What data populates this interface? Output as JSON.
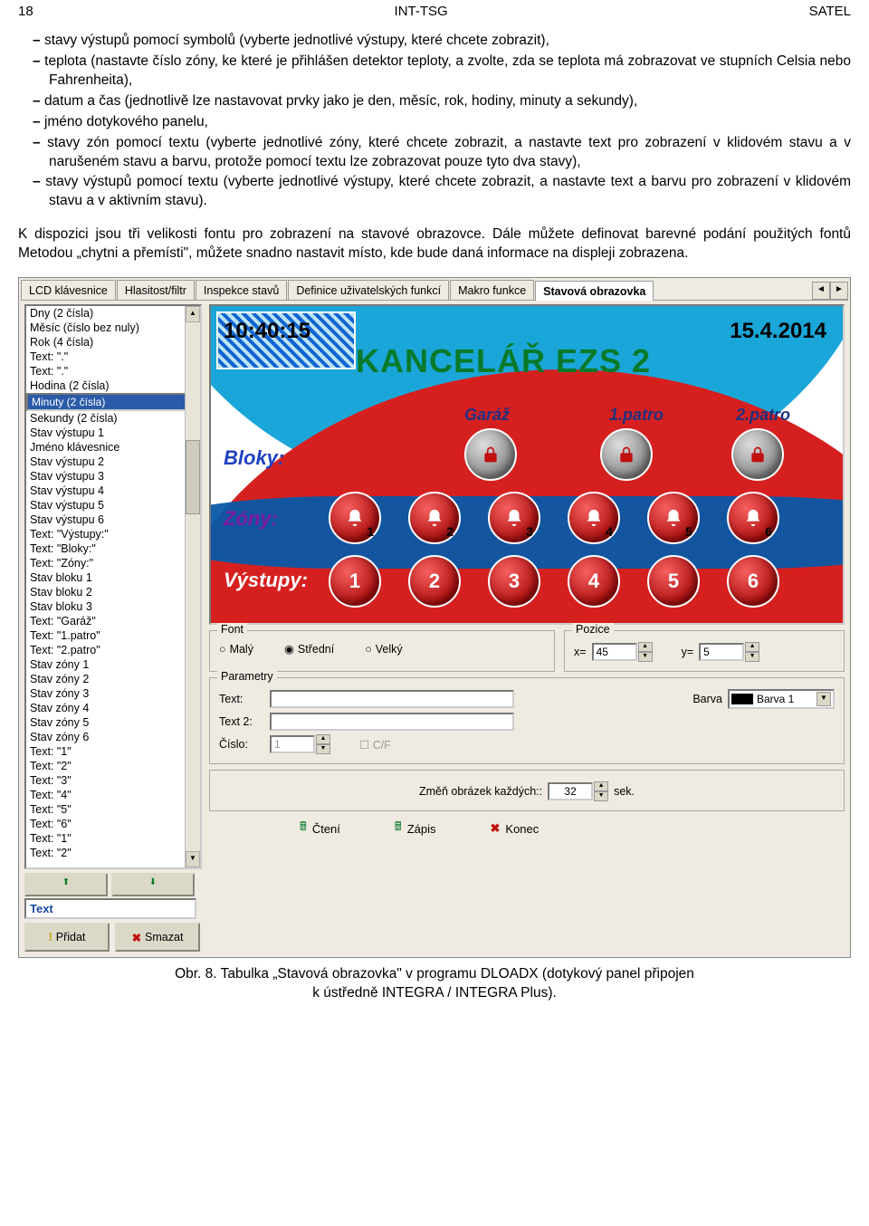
{
  "header": {
    "page": "18",
    "center": "INT-TSG",
    "right": "SATEL"
  },
  "text": {
    "li1": "stavy výstupů pomocí symbolů (vyberte jednotlivé výstupy, které chcete zobrazit),",
    "li2": "teplota (nastavte číslo zóny, ke které je přihlášen detektor teploty, a zvolte, zda se teplota má zobrazovat ve stupních Celsia nebo Fahrenheita),",
    "li3": "datum a čas (jednotlivě lze nastavovat prvky jako je den, měsíc, rok, hodiny, minuty a sekundy),",
    "li4": "jméno dotykového panelu,",
    "li5": "stavy zón pomocí textu (vyberte jednotlivé zóny, které chcete zobrazit, a nastavte text pro zobrazení v klidovém stavu a v narušeném stavu a barvu, protože pomocí textu lze zobrazovat pouze tyto dva stavy),",
    "li6": "stavy výstupů pomocí textu (vyberte jednotlivé výstupy, které chcete zobrazit, a nastavte text a barvu pro zobrazení v klidovém stavu a v aktivním stavu).",
    "para": "K dispozici jsou tři velikosti fontu pro zobrazení na stavové obrazovce. Dále můžete definovat barevné podání použitých fontů Metodou „chytni a přemísti\", můžete snadno nastavit místo, kde bude daná informace na displeji zobrazena."
  },
  "tabs": {
    "t1": "LCD klávesnice",
    "t2": "Hlasitost/filtr",
    "t3": "Inspekce stavů",
    "t4": "Definice uživatelských funkcí",
    "t5": "Makro funkce",
    "t6": "Stavová obrazovka"
  },
  "list": [
    "Dny (2 čísla)",
    "Měsíc (číslo bez nuly)",
    "Rok (4 čísla)",
    "Text: \".\"",
    "Text: \".\"",
    "Hodina (2 čísla)",
    "Minuty (2 čísla)",
    "Sekundy (2 čísla)",
    "Stav výstupu 1",
    "Jméno klávesnice",
    "Stav výstupu 2",
    "Stav výstupu 3",
    "Stav výstupu 4",
    "Stav výstupu 5",
    "Stav výstupu 6",
    "Text: \"Výstupy:\"",
    "Text: \"Bloky:\"",
    "Text: \"Zóny:\"",
    "Stav bloku 1",
    "Stav bloku 2",
    "Stav bloku 3",
    "Text: \"Garáž\"",
    "Text: \"1.patro\"",
    "Text: \"2.patro\"",
    "Stav zóny 1",
    "Stav zóny 2",
    "Stav zóny 3",
    "Stav zóny 4",
    "Stav zóny 5",
    "Stav zóny 6",
    "Text: \"1\"",
    "Text: \"2\"",
    "Text: \"3\"",
    "Text: \"4\"",
    "Text: \"5\"",
    "Text: \"6\"",
    "Text: \"1\"",
    "Text: \"2\""
  ],
  "list_selected": 6,
  "preview": {
    "time": "10:40:15",
    "date": "15.4.2014",
    "title": "KANCELÁŘ EZS 2",
    "garaz": "Garáž",
    "p1": "1.patro",
    "p2": "2.patro",
    "bloky": "Bloky:",
    "zony": "Zóny:",
    "vystupy": "Výstupy:",
    "zone_nums": [
      "1",
      "2",
      "3",
      "4",
      "5",
      "6"
    ],
    "out_nums": [
      "1",
      "2",
      "3",
      "4",
      "5",
      "6"
    ]
  },
  "font": {
    "legend": "Font",
    "r1": "Malý",
    "r2": "Střední",
    "r3": "Velký",
    "selected": "r2"
  },
  "pozice": {
    "legend": "Pozice",
    "xl": "x=",
    "xv": "45",
    "yl": "y=",
    "yv": "5"
  },
  "params": {
    "legend": "Parametry",
    "t1": "Text:",
    "t2": "Text 2:",
    "cis": "Číslo:",
    "cisv": "1",
    "cf": "C/F",
    "barva": "Barva",
    "barvav": "Barva 1"
  },
  "change": {
    "label": "Změň obrázek každých::",
    "val": "32",
    "unit": "sek."
  },
  "textfield": "Text",
  "btns": {
    "add": "Přidat",
    "del": "Smazat",
    "read": "Čtení",
    "write": "Zápis",
    "close": "Konec",
    "up": "▲",
    "down": "▼"
  },
  "caption": {
    "l1": "Obr. 8. Tabulka „Stavová obrazovka\" v programu DLOADX (dotykový panel připojen",
    "l2": "k ústředně INTEGRA / INTEGRA Plus)."
  }
}
